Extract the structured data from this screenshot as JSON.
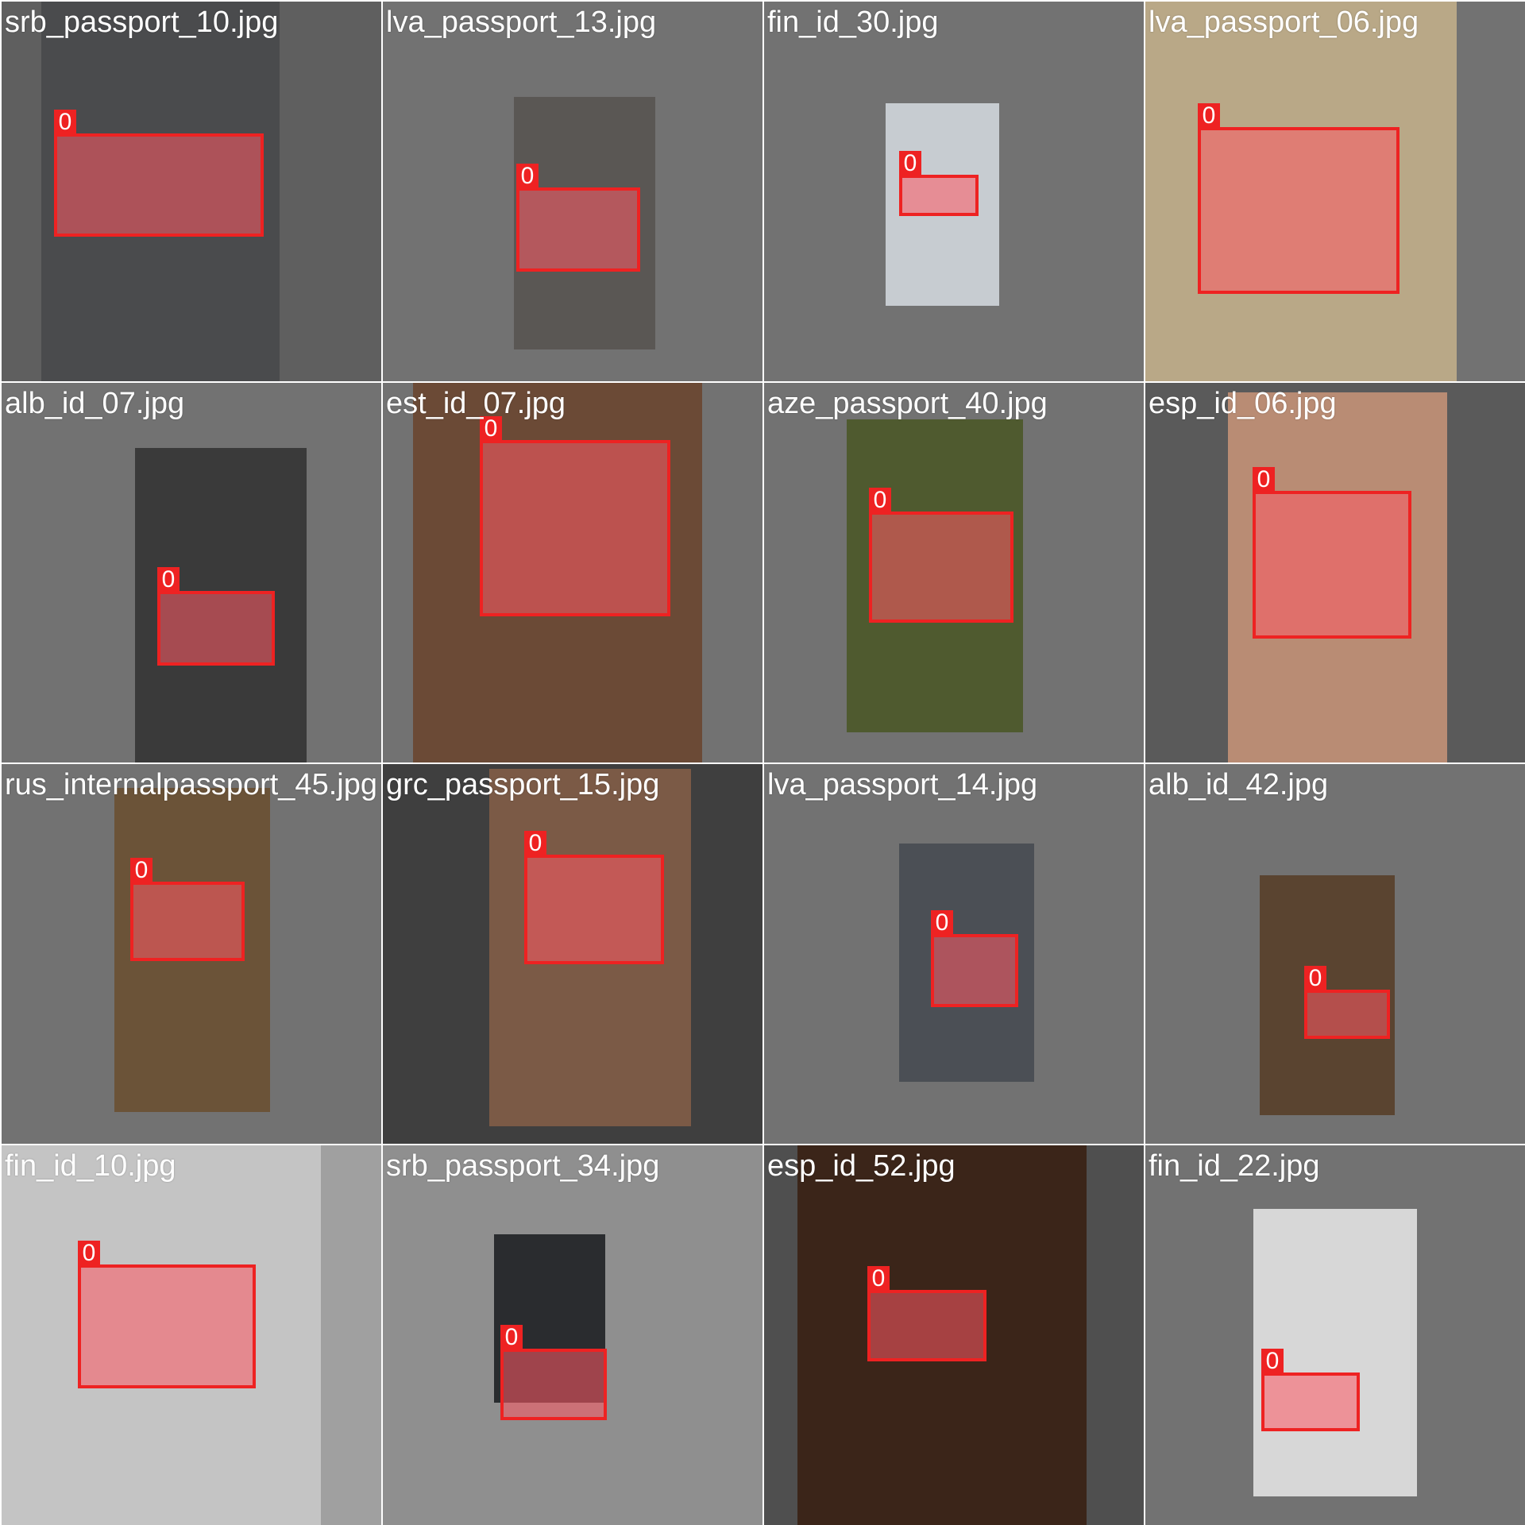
{
  "tiles": [
    {
      "filename": "srb_passport_10.jpg",
      "label": "0",
      "bg": "#5f5f5f",
      "photo_color": "#4a4b4d"
    },
    {
      "filename": "lva_passport_13.jpg",
      "label": "0",
      "bg": "#727272",
      "photo_color": "#5a5754"
    },
    {
      "filename": "fin_id_30.jpg",
      "label": "0",
      "bg": "#727272",
      "photo_color": "#c7ccd1"
    },
    {
      "filename": "lva_passport_06.jpg",
      "label": "0",
      "bg": "#727272",
      "photo_color": "#b9a887"
    },
    {
      "filename": "alb_id_07.jpg",
      "label": "0",
      "bg": "#727272",
      "photo_color": "#3a3a3a"
    },
    {
      "filename": "est_id_07.jpg",
      "label": "0",
      "bg": "#727272",
      "photo_color": "#6b4a36"
    },
    {
      "filename": "aze_passport_40.jpg",
      "label": "0",
      "bg": "#727272",
      "photo_color": "#4f5a2f"
    },
    {
      "filename": "esp_id_06.jpg",
      "label": "0",
      "bg": "#5a5a5a",
      "photo_color": "#b98c74"
    },
    {
      "filename": "rus_internalpassport_45.jpg",
      "label": "0",
      "bg": "#727272",
      "photo_color": "#6b5338"
    },
    {
      "filename": "grc_passport_15.jpg",
      "label": "0",
      "bg": "#3f3f3f",
      "photo_color": "#7b5a46"
    },
    {
      "filename": "lva_passport_14.jpg",
      "label": "0",
      "bg": "#727272",
      "photo_color": "#4b4f55"
    },
    {
      "filename": "alb_id_42.jpg",
      "label": "0",
      "bg": "#727272",
      "photo_color": "#5a4430"
    },
    {
      "filename": "fin_id_10.jpg",
      "label": "0",
      "bg": "#a0a0a0",
      "photo_color": "#c4c4c4"
    },
    {
      "filename": "srb_passport_34.jpg",
      "label": "0",
      "bg": "#8f8f8f",
      "photo_color": "#2a2c2f"
    },
    {
      "filename": "esp_id_52.jpg",
      "label": "0",
      "bg": "#4f4f4f",
      "photo_color": "#3b2519"
    },
    {
      "filename": "fin_id_22.jpg",
      "label": "0",
      "bg": "#727272",
      "photo_color": "#d7d7d7"
    }
  ]
}
